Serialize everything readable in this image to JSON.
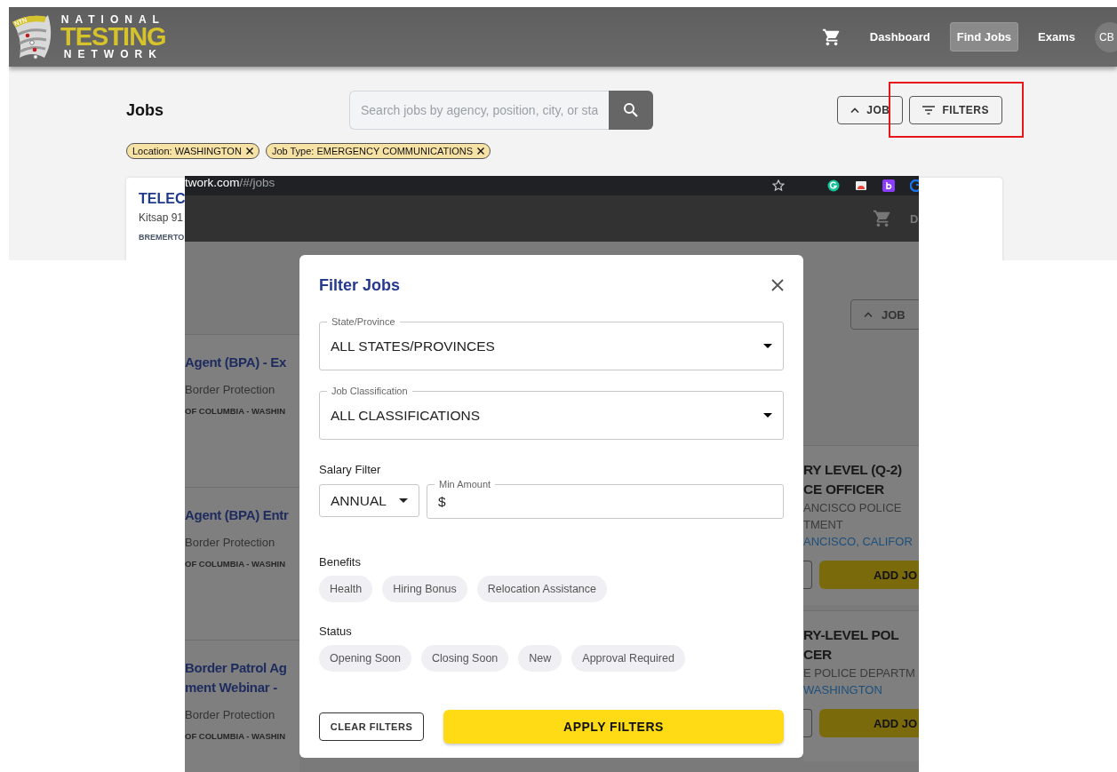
{
  "main_screenshot": {
    "logo": {
      "badge": "NTN",
      "line_1": "NATIONAL",
      "line_2": "TESTING",
      "line_3": "NETWORK"
    },
    "nav": [
      {
        "label": "Dashboard",
        "selected": false
      },
      {
        "label": "Find Jobs",
        "selected": true
      },
      {
        "label": "Exams",
        "selected": false
      }
    ],
    "avatar": "CB",
    "page_title": "Jobs",
    "search": {
      "placeholder": "Search jobs by agency, position, city, or sta"
    },
    "toolbar_buttons": [
      {
        "kind": "sort",
        "label": "JOB",
        "highlighted": false
      },
      {
        "kind": "filter",
        "label": "FILTERS",
        "highlighted": true
      }
    ],
    "active_filters": [
      "Location: WASHINGTON",
      "Job Type: EMERGENCY COMMUNICATIONS"
    ],
    "job_card": {
      "title": "TELEC",
      "agency": "Kitsap 91",
      "location": "BREMERTO"
    }
  },
  "overlay_screenshot": {
    "address_bar": {
      "host": "twork.com",
      "path": "/#/jobs"
    },
    "nav_fragment": "D",
    "sort_button": "JOB",
    "left_jobs": [
      {
        "title_lines": [
          "Agent (BPA) - Ex"
        ],
        "agency": "Border Protection",
        "location": "OF COLUMBIA - WASHIN"
      },
      {
        "title_lines": [
          "Agent (BPA) Entr"
        ],
        "agency": "Border Protection",
        "location": "OF COLUMBIA - WASHIN"
      },
      {
        "title_lines": [
          "Border Patrol Ag",
          "ment Webinar - "
        ],
        "agency": "Border Protection",
        "location": "OF COLUMBIA - WASHIN"
      }
    ],
    "right_jobs": [
      {
        "title_lines": [
          "RY LEVEL (Q-2)",
          "CE OFFICER"
        ],
        "agency_lines": [
          "ANCISCO POLICE",
          "TMENT"
        ],
        "location": "ANCISCO, CALIFOR",
        "action": "ADD JO"
      },
      {
        "title_lines": [
          "RY-LEVEL POL",
          "CER"
        ],
        "agency_lines": [
          "E POLICE DEPARTM"
        ],
        "location": "WASHINGTON",
        "action": "ADD JO"
      }
    ],
    "filter_dialog": {
      "title": "Filter Jobs",
      "selects": [
        {
          "label": "State/Province",
          "value": "ALL STATES/PROVINCES"
        },
        {
          "label": "Job Classification",
          "value": "ALL CLASSIFICATIONS"
        }
      ],
      "salary": {
        "heading": "Salary Filter",
        "period": "ANNUAL",
        "min_label": "Min Amount",
        "prefix": "$"
      },
      "benefits": {
        "heading": "Benefits",
        "options": [
          {
            "label": "Health",
            "selected": false
          },
          {
            "label": "Hiring Bonus",
            "selected": false
          },
          {
            "label": "Relocation Assistance",
            "selected": false
          }
        ]
      },
      "status": {
        "heading": "Status",
        "options": [
          {
            "label": "Opening Soon",
            "selected": false
          },
          {
            "label": "Closing Soon",
            "selected": false
          },
          {
            "label": "New",
            "selected": false
          },
          {
            "label": "Approval Required",
            "selected": false
          }
        ]
      },
      "clear_button": "CLEAR FILTERS",
      "apply_button": "APPLY FILTERS"
    }
  }
}
